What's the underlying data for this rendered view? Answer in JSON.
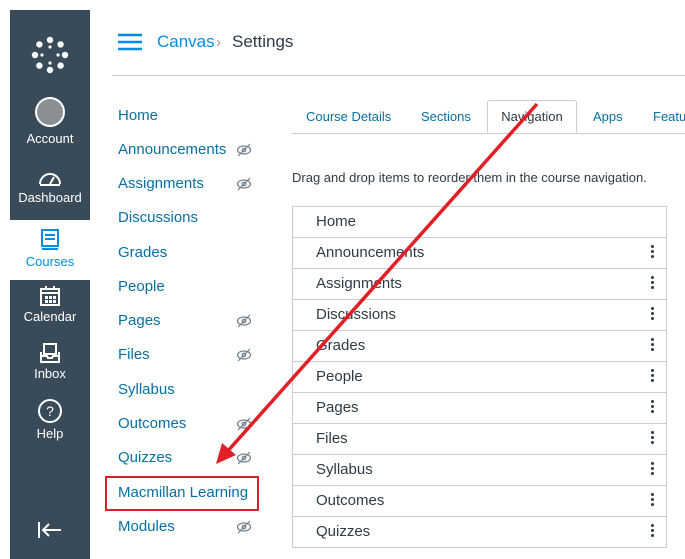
{
  "global_nav": {
    "items": [
      {
        "label": "Account",
        "icon": "avatar-icon"
      },
      {
        "label": "Dashboard",
        "icon": "dashboard-icon"
      },
      {
        "label": "Courses",
        "icon": "courses-icon",
        "active": true
      },
      {
        "label": "Calendar",
        "icon": "calendar-icon"
      },
      {
        "label": "Inbox",
        "icon": "inbox-icon"
      },
      {
        "label": "Help",
        "icon": "help-icon"
      }
    ]
  },
  "header": {
    "breadcrumb_root": "Canvas",
    "separator": "›",
    "breadcrumb_current": "Settings"
  },
  "course_nav": {
    "items": [
      {
        "label": "Home",
        "hidden": false
      },
      {
        "label": "Announcements",
        "hidden": true
      },
      {
        "label": "Assignments",
        "hidden": true
      },
      {
        "label": "Discussions",
        "hidden": false
      },
      {
        "label": "Grades",
        "hidden": false
      },
      {
        "label": "People",
        "hidden": false
      },
      {
        "label": "Pages",
        "hidden": true
      },
      {
        "label": "Files",
        "hidden": true
      },
      {
        "label": "Syllabus",
        "hidden": false
      },
      {
        "label": "Outcomes",
        "hidden": true
      },
      {
        "label": "Quizzes",
        "hidden": true
      },
      {
        "label": "Macmillan Learning",
        "hidden": false
      },
      {
        "label": "Modules",
        "hidden": true
      }
    ]
  },
  "tabs": [
    {
      "label": "Course Details"
    },
    {
      "label": "Sections"
    },
    {
      "label": "Navigation",
      "active": true
    },
    {
      "label": "Apps"
    },
    {
      "label": "Featu"
    }
  ],
  "instructions": "Drag and drop items to reorder them in the course navigation.",
  "nav_list": [
    {
      "label": "Home",
      "menu": false
    },
    {
      "label": "Announcements",
      "menu": true
    },
    {
      "label": "Assignments",
      "menu": true
    },
    {
      "label": "Discussions",
      "menu": true
    },
    {
      "label": "Grades",
      "menu": true
    },
    {
      "label": "People",
      "menu": true
    },
    {
      "label": "Pages",
      "menu": true
    },
    {
      "label": "Files",
      "menu": true
    },
    {
      "label": "Syllabus",
      "menu": true
    },
    {
      "label": "Outcomes",
      "menu": true
    },
    {
      "label": "Quizzes",
      "menu": true
    }
  ],
  "colors": {
    "global_nav_bg": "#394b58",
    "link": "#0770a3",
    "brand_blue": "#008ee2",
    "annotation_red": "#e01f26"
  }
}
